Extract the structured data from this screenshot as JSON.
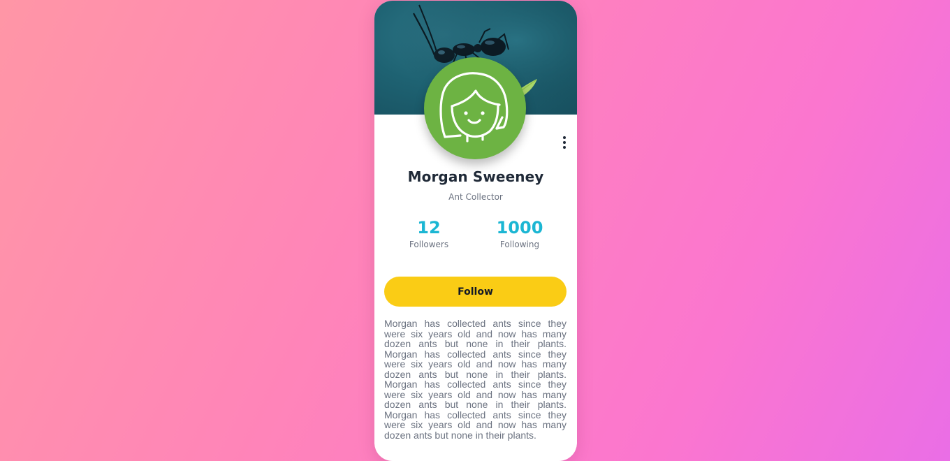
{
  "profile": {
    "name": "Morgan Sweeney",
    "role": "Ant Collector",
    "cover_image": "ant-on-leaf-photo",
    "avatar_icon": "girl-face-avatar-icon",
    "more_icon": "vertical-ellipsis-icon"
  },
  "stats": [
    {
      "value": "12",
      "label": "Followers"
    },
    {
      "value": "1000",
      "label": "Following"
    }
  ],
  "actions": {
    "follow_label": "Follow"
  },
  "bio": "Morgan has collected ants since they were six years old and now has many dozen ants but none in their plants. Morgan has collected ants since they were six years old and now has many dozen ants but none in their plants. Morgan has collected ants since they were six years old and now has many dozen ants but none in their plants. Morgan has collected ants since they were six years old and now has many dozen ants but none in their plants.",
  "colors": {
    "accent": "#1bb6d3",
    "button": "#facc15",
    "avatar_bg": "#6db343",
    "cover_bg": "#1e6272"
  }
}
